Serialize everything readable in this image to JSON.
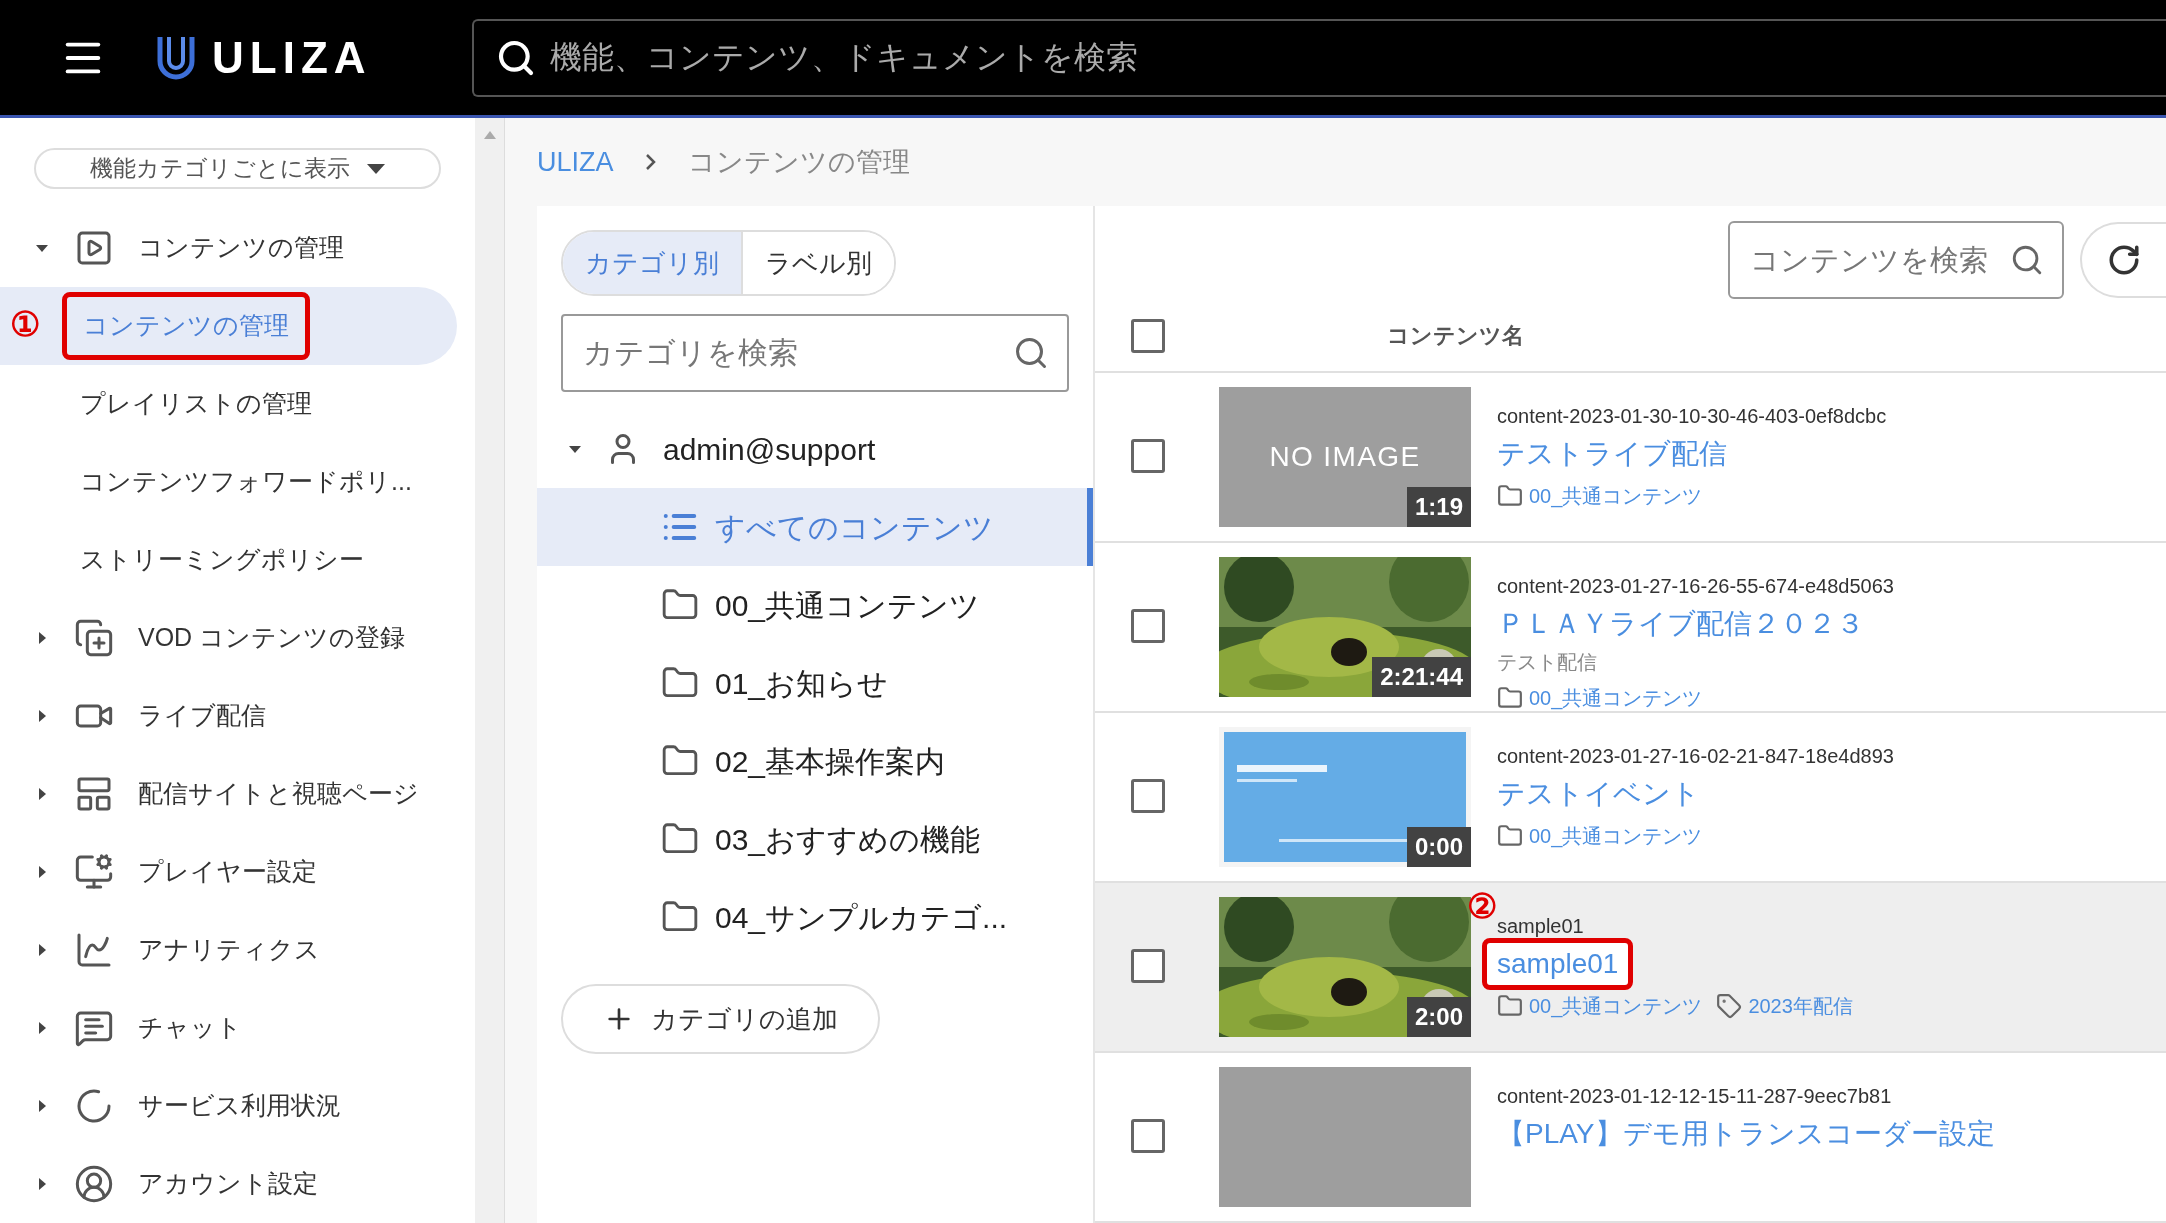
{
  "header": {
    "logo": "ULIZA",
    "search_placeholder": "機能、コンテンツ、ドキュメントを検索"
  },
  "sidebar": {
    "view_select": "機能カテゴリごとに表示",
    "items": [
      {
        "label": "コンテンツの管理",
        "expanded": true,
        "children": [
          {
            "label": "コンテンツの管理",
            "selected": true,
            "annotation": "①"
          },
          {
            "label": "プレイリストの管理",
            "selected": false
          },
          {
            "label": "コンテンツフォワードポリ...",
            "selected": false
          },
          {
            "label": "ストリーミングポリシー",
            "selected": false
          }
        ]
      },
      {
        "label": "VOD コンテンツの登録",
        "expanded": false
      },
      {
        "label": "ライブ配信",
        "expanded": false
      },
      {
        "label": "配信サイトと視聴ページ",
        "expanded": false
      },
      {
        "label": "プレイヤー設定",
        "expanded": false
      },
      {
        "label": "アナリティクス",
        "expanded": false
      },
      {
        "label": "チャット",
        "expanded": false
      },
      {
        "label": "サービス利用状況",
        "expanded": false
      },
      {
        "label": "アカウント設定",
        "expanded": false
      }
    ]
  },
  "breadcrumb": [
    "ULIZA",
    "コンテンツの管理"
  ],
  "category_panel": {
    "tabs": [
      {
        "label": "カテゴリ別",
        "selected": true
      },
      {
        "label": "ラベル別",
        "selected": false
      }
    ],
    "search_placeholder": "カテゴリを検索",
    "tree": {
      "label": "admin@support",
      "expanded": true,
      "children": [
        {
          "label": "すべてのコンテンツ",
          "kind": "all",
          "selected": true
        },
        {
          "label": "00_共通コンテンツ",
          "kind": "folder",
          "selected": false
        },
        {
          "label": "01_お知らせ",
          "kind": "folder",
          "selected": false
        },
        {
          "label": "02_基本操作案内",
          "kind": "folder",
          "selected": false
        },
        {
          "label": "03_おすすめの機能",
          "kind": "folder",
          "selected": false
        },
        {
          "label": "04_サンプルカテゴ...",
          "kind": "folder",
          "selected": false
        }
      ]
    },
    "add_button": "カテゴリの追加"
  },
  "content_list": {
    "search_placeholder": "コンテンツを検索",
    "column": "コンテンツ名",
    "select_all_checked": false,
    "rows": [
      {
        "id": "content-2023-01-30-10-30-46-403-0ef8dcbc",
        "title": "テストライブ配信",
        "thumbnail": {
          "kind": "placeholder",
          "text": "NO IMAGE"
        },
        "duration": "1:19",
        "category": "00_共通コンテンツ",
        "checked": false,
        "highlighted": false
      },
      {
        "id": "content-2023-01-27-16-26-55-674-e48d5063",
        "title": "ＰＬＡＹライブ配信２０２３",
        "description": "テスト配信",
        "duration": "2:21:44",
        "category": "00_共通コンテンツ",
        "checked": false,
        "highlighted": false
      },
      {
        "id": "content-2023-01-27-16-02-21-847-18e4d893",
        "title": "テストイベント",
        "thumbnail": {
          "kind": "slide"
        },
        "duration": "0:00",
        "category": "00_共通コンテンツ",
        "checked": false,
        "highlighted": false
      },
      {
        "id": "sample01",
        "title": "sample01",
        "duration": "2:00",
        "category": "00_共通コンテンツ",
        "label": "2023年配信",
        "checked": false,
        "highlighted": true,
        "annotation": "②"
      },
      {
        "id": "content-2023-01-12-12-15-11-287-9eec7b81",
        "title": "【PLAY】デモ用トランスコーダー設定",
        "thumbnail": {
          "kind": "placeholder"
        },
        "checked": false,
        "highlighted": false
      }
    ]
  }
}
